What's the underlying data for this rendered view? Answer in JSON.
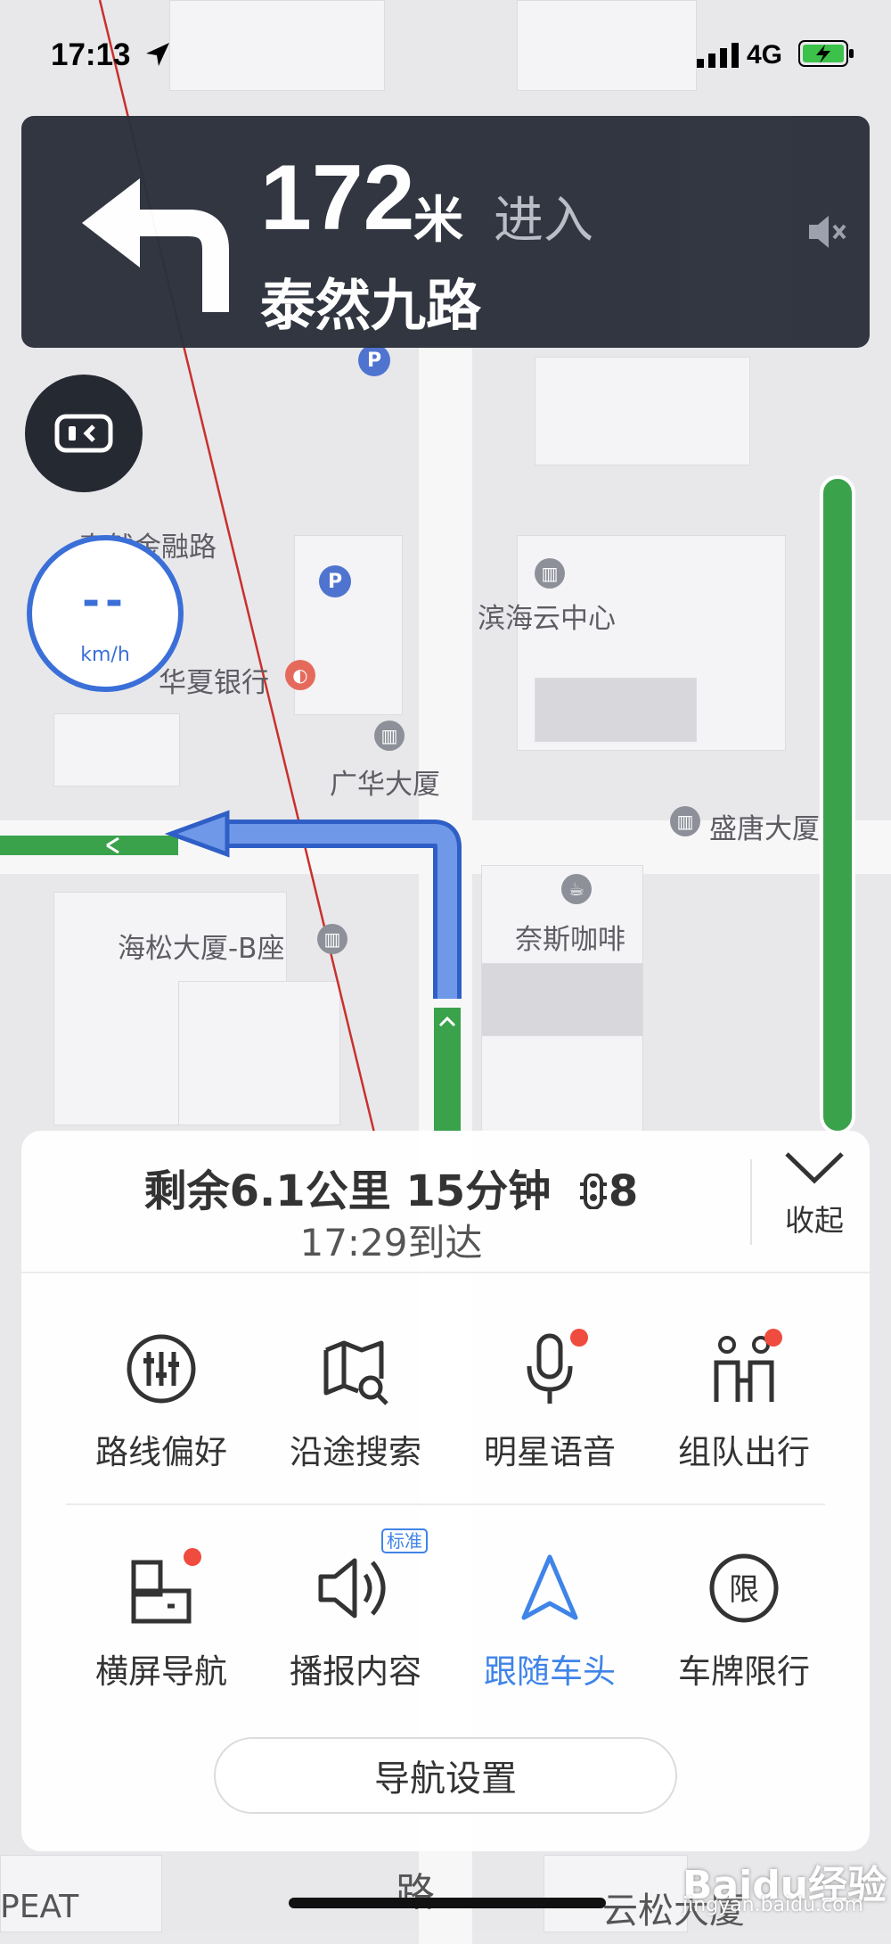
{
  "status_bar": {
    "time": "17:13",
    "network": "4G"
  },
  "guidance": {
    "distance": "172",
    "unit": "米",
    "action": "进入",
    "road": "泰然九路"
  },
  "speed": {
    "value": "--",
    "unit": "km/h"
  },
  "map_labels": {
    "poi_1": "泰然金融路",
    "poi_2": "滨海云中心",
    "poi_3": "华夏银行",
    "poi_4": "广华大厦",
    "poi_5": "盛唐大厦",
    "poi_6": "海松大厦-B座",
    "poi_7": "奈斯咖啡",
    "poi_8": "云松大厦",
    "poi_9": "路",
    "poi_10": "PEAT"
  },
  "trip": {
    "remaining": "剩余6.1公里 15分钟",
    "lights": "8",
    "arrival": "17:29到达",
    "collapse_label": "收起"
  },
  "menu": {
    "items": [
      {
        "label": "路线偏好",
        "icon": "sliders-icon"
      },
      {
        "label": "沿途搜索",
        "icon": "map-search-icon"
      },
      {
        "label": "明星语音",
        "icon": "microphone-icon"
      },
      {
        "label": "组队出行",
        "icon": "team-icon"
      },
      {
        "label": "横屏导航",
        "icon": "landscape-icon"
      },
      {
        "label": "播报内容",
        "icon": "speaker-icon",
        "badge": "标准"
      },
      {
        "label": "跟随车头",
        "icon": "heading-arrow-icon"
      },
      {
        "label": "车牌限行",
        "icon": "restriction-icon",
        "icon_text": "限"
      }
    ],
    "settings_label": "导航设置"
  },
  "watermark": {
    "brand": "Baidu经验",
    "url": "jingyan.baidu.com"
  },
  "colors": {
    "accent": "#3f84e8",
    "route": "#3b6fd8",
    "panel": "#2c313c",
    "dot": "#ef4b3e",
    "green": "#3aa24b"
  }
}
